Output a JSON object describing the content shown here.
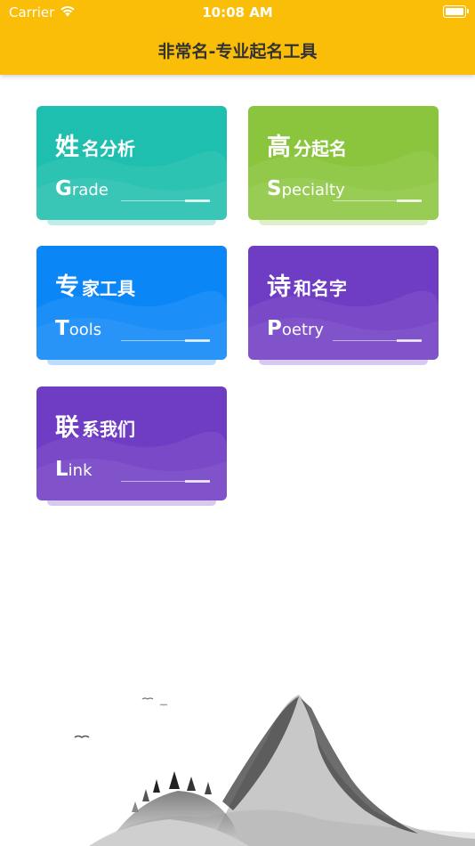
{
  "status_bar": {
    "carrier": "Carrier",
    "time": "10:08 AM"
  },
  "header": {
    "title": "非常名-专业起名工具"
  },
  "cards": [
    {
      "cn_first": "姓",
      "cn_rest": "名分析",
      "en_first": "G",
      "en_rest": "rade",
      "color": "#1EBFAE",
      "color2": "#27C5B4"
    },
    {
      "cn_first": "高",
      "cn_rest": "分起名",
      "en_first": "S",
      "en_rest": "pecialty",
      "color": "#8BC53E",
      "color2": "#96CB48"
    },
    {
      "cn_first": "专",
      "cn_rest": "家工具",
      "en_first": "T",
      "en_rest": "ools",
      "color": "#0A86F7",
      "color2": "#1A8EFA"
    },
    {
      "cn_first": "诗",
      "cn_rest": "和名字",
      "en_first": "P",
      "en_rest": "oetry",
      "color": "#6F3CC4",
      "color2": "#7544C8"
    },
    {
      "cn_first": "联",
      "cn_rest": "系我们",
      "en_first": "L",
      "en_rest": "ink",
      "color": "#6F3CC4",
      "color2": "#7544C8"
    }
  ]
}
